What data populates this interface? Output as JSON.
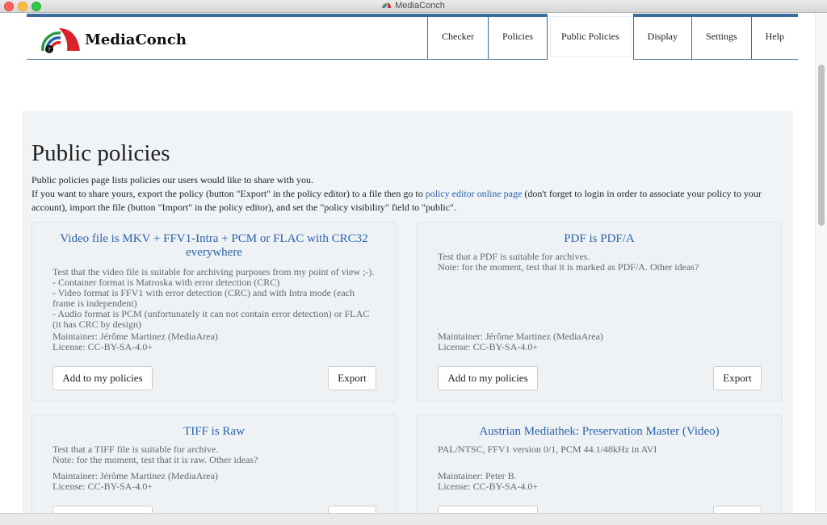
{
  "window": {
    "title": "MediaConch"
  },
  "brand": {
    "name": "MediaConch"
  },
  "nav": [
    {
      "label": "Checker"
    },
    {
      "label": "Policies"
    },
    {
      "label": "Public Policies"
    },
    {
      "label": "Display"
    },
    {
      "label": "Settings"
    },
    {
      "label": "Help"
    }
  ],
  "page": {
    "title": "Public policies",
    "intro_line1": "Public policies page lists policies our users would like to share with you.",
    "intro_line2a": "If you want to share yours, export the policy (button \"Export\" in the policy editor) to a file then go to ",
    "intro_link": "policy editor online page",
    "intro_line2b": " (don't forget to login in order to associate your policy to your account), import the file (button \"Import\" in the policy editor), and set the \"policy visibility\" field to \"public\"."
  },
  "buttons": {
    "add": "Add to my policies",
    "export": "Export"
  },
  "policies": [
    {
      "title": "Video file is MKV + FFV1-Intra + PCM or FLAC with CRC32 everywhere",
      "description": "Test that the video file is suitable for archiving purposes from my point of view ;-).\n- Container format is Matroska with error detection (CRC)\n- Video format is FFV1 with error detection (CRC) and with Intra mode (each frame is independent)\n- Audio format is PCM (unfortunately it can not contain error detection) or FLAC (it has CRC by design)",
      "maintainer": "Maintainer: Jérôme Martinez (MediaArea)",
      "license": "License: CC-BY-SA-4.0+"
    },
    {
      "title": "PDF is PDF/A",
      "description": "Test that a PDF is suitable for archives.\nNote: for the moment, test that it is marked as PDF/A. Other ideas?",
      "maintainer": "Maintainer: Jérôme Martinez (MediaArea)",
      "license": "License: CC-BY-SA-4.0+"
    },
    {
      "title": "TIFF is Raw",
      "description": "Test that a TIFF file is suitable for archive.\nNote: for the moment, test that it is raw. Other ideas?",
      "maintainer": "Maintainer: Jérôme Martinez (MediaArea)",
      "license": "License: CC-BY-SA-4.0+"
    },
    {
      "title": "Austrian Mediathek: Preservation Master (Video)",
      "description": "PAL/NTSC, FFV1 version 0/1, PCM 44.1/48kHz in AVI",
      "maintainer": "Maintainer: Peter B.",
      "license": "License: CC-BY-SA-4.0+"
    }
  ]
}
